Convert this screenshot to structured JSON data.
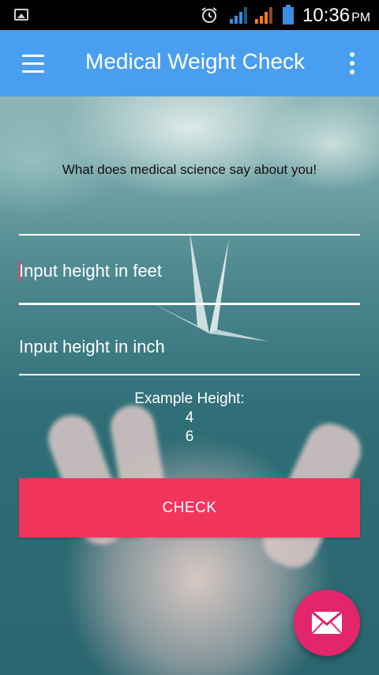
{
  "status_bar": {
    "time": "10:36",
    "ampm": "PM",
    "icons": [
      "image-notification-icon",
      "alarm-icon",
      "signal-icon",
      "signal-icon",
      "battery-icon"
    ]
  },
  "app_bar": {
    "title": "Medical Weight Check",
    "menu_icon": "hamburger-menu-icon",
    "overflow_icon": "more-vert-icon",
    "color": "#4a9ef0"
  },
  "main": {
    "subtitle": "What does medical science say about you!",
    "feet_input": {
      "value": "",
      "placeholder": "Input height in feet"
    },
    "inch_input": {
      "value": "",
      "placeholder": "Input height in inch"
    },
    "example_label": "Example Height:",
    "example_feet": "4",
    "example_inch": "6",
    "check_label": "CHECK",
    "check_color": "#f2355b"
  },
  "fab": {
    "icon": "mail-icon",
    "color": "#e3256b"
  }
}
